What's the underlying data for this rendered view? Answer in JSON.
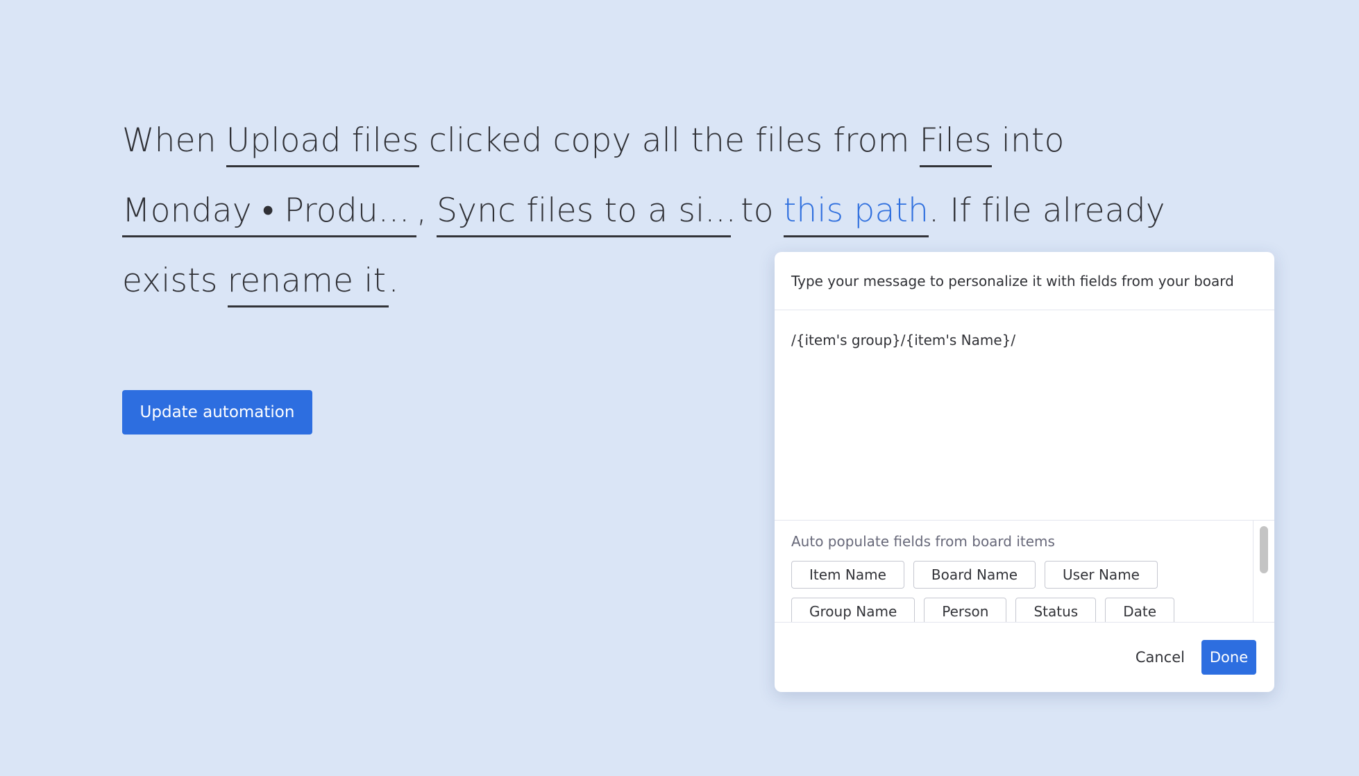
{
  "sentence": {
    "when": "When",
    "trigger_button": "Upload files",
    "clicked_copy": "clicked copy all the files from",
    "source_column": "Files",
    "into": "into",
    "destination_board": "Monday • Produ...",
    "comma": ",",
    "integration": "Sync files to a si...",
    "to": "to",
    "path_link": "this path",
    "if_exists": ". If file already",
    "exists": "exists",
    "conflict_action": "rename it",
    "period": "."
  },
  "update_button": "Update automation",
  "dialog": {
    "header": "Type your message to personalize it with fields from your board",
    "editor_value": "/{item's group}/{item's Name}/",
    "fields_title": "Auto populate fields from board items",
    "field_chips": [
      [
        "Item Name",
        "Board Name",
        "User Name"
      ],
      [
        "Group Name",
        "Person",
        "Status",
        "Date"
      ]
    ],
    "cancel": "Cancel",
    "done": "Done"
  },
  "colors": {
    "background": "#dae5f6",
    "accent": "#2d6ee0",
    "link": "#2f6fde",
    "text": "#323338"
  }
}
